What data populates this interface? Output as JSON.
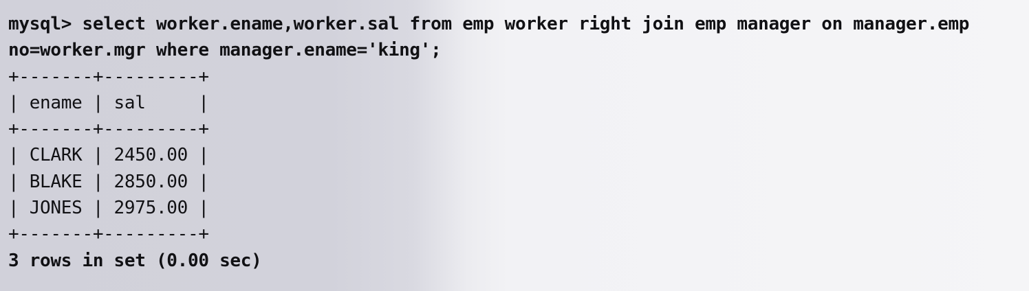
{
  "terminal": {
    "prompt": "mysql> ",
    "command_line1": "select worker.ename,worker.sal from emp worker right join emp manager on manager.emp",
    "command_line2": "no=worker.mgr where manager.ename='king';"
  },
  "result_table": {
    "border": "+-------+---------+",
    "header": "| ename | sal     |",
    "columns": [
      "ename",
      "sal"
    ],
    "rows": [
      {
        "ename": "CLARK",
        "sal": "2450.00",
        "text": "| CLARK | 2450.00 |"
      },
      {
        "ename": "BLAKE",
        "sal": "2850.00",
        "text": "| BLAKE | 2850.00 |"
      },
      {
        "ename": "JONES",
        "sal": "2975.00",
        "text": "| JONES | 2975.00 |"
      }
    ]
  },
  "status": "3 rows in set (0.00 sec)",
  "colors": {
    "text": "#111114",
    "background_left": "#d1d1da",
    "background_right": "#f5f5f7"
  }
}
